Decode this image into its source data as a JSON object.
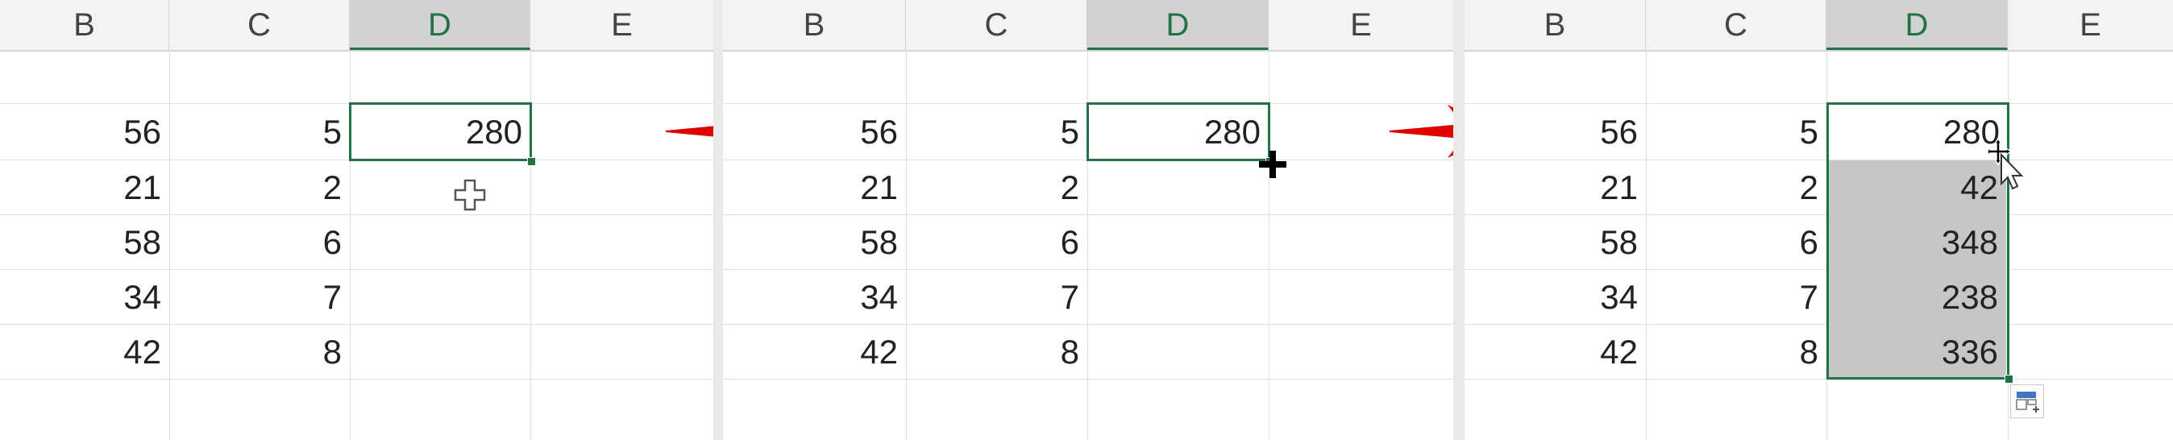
{
  "panels": [
    {
      "columns": [
        "B",
        "C",
        "D",
        "E"
      ],
      "active_column": "D",
      "rows": [
        {
          "b": "56",
          "c": "5",
          "d": "280"
        },
        {
          "b": "21",
          "c": "2",
          "d": ""
        },
        {
          "b": "58",
          "c": "6",
          "d": ""
        },
        {
          "b": "34",
          "c": "7",
          "d": ""
        },
        {
          "b": "42",
          "c": "8",
          "d": ""
        }
      ]
    },
    {
      "columns": [
        "B",
        "C",
        "D",
        "E"
      ],
      "active_column": "D",
      "rows": [
        {
          "b": "56",
          "c": "5",
          "d": "280"
        },
        {
          "b": "21",
          "c": "2",
          "d": ""
        },
        {
          "b": "58",
          "c": "6",
          "d": ""
        },
        {
          "b": "34",
          "c": "7",
          "d": ""
        },
        {
          "b": "42",
          "c": "8",
          "d": ""
        }
      ]
    },
    {
      "columns": [
        "B",
        "C",
        "D",
        "E"
      ],
      "active_column": "D",
      "rows": [
        {
          "b": "56",
          "c": "5",
          "d": "280"
        },
        {
          "b": "21",
          "c": "2",
          "d": "42"
        },
        {
          "b": "58",
          "c": "6",
          "d": "348"
        },
        {
          "b": "34",
          "c": "7",
          "d": "238"
        },
        {
          "b": "42",
          "c": "8",
          "d": "336"
        }
      ]
    }
  ],
  "colors": {
    "selection_border": "#217346",
    "fill_highlight": "#c6c6c6",
    "arrow": "#e00000"
  },
  "icons": {
    "cursor_panel_1": "white-cross-cursor-icon",
    "cursor_panel_2": "fill-handle-crosshair-icon",
    "cursor_panel_3": "move-arrow-cursor-icon",
    "autofill_options": "auto-fill-options-icon"
  }
}
